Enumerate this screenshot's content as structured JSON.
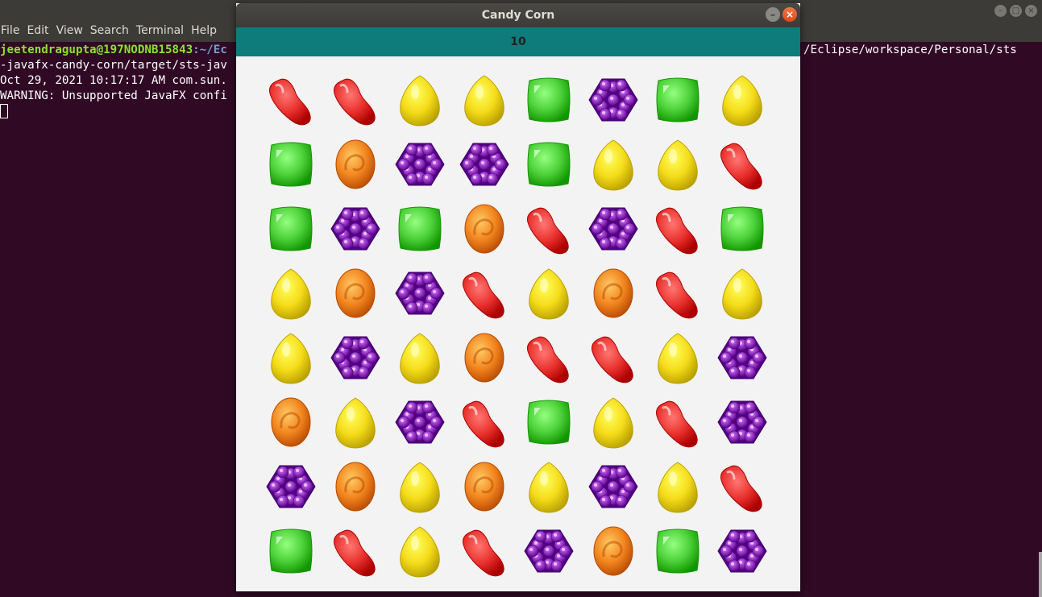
{
  "terminal": {
    "menu": [
      "File",
      "Edit",
      "View",
      "Search",
      "Terminal",
      "Help"
    ],
    "prompt_user": "jeetendragupta@197NODNB15843",
    "prompt_path": ":~/Ec",
    "path_right": "/Eclipse/workspace/Personal/sts",
    "line2": "-javafx-candy-corn/target/sts-jav",
    "line3": "Oct 29, 2021 10:17:17 AM com.sun.",
    "line4": "WARNING: Unsupported JavaFX confi"
  },
  "window": {
    "title": "Candy Corn",
    "score": "10"
  },
  "colors": {
    "red": "#e8302c",
    "yellow": "#f5dc1a",
    "green": "#4ed23a",
    "orange": "#f2851f",
    "purple": "#8e2fbd",
    "teal": "#0e7c7b"
  },
  "board": [
    [
      "red",
      "red",
      "yellow",
      "yellow",
      "green",
      "purple",
      "green",
      "yellow"
    ],
    [
      "green",
      "orange",
      "purple",
      "purple",
      "green",
      "yellow",
      "yellow",
      "red"
    ],
    [
      "green",
      "purple",
      "green",
      "orange",
      "red",
      "purple",
      "red",
      "green"
    ],
    [
      "yellow",
      "orange",
      "purple",
      "red",
      "yellow",
      "orange",
      "red",
      "yellow"
    ],
    [
      "yellow",
      "purple",
      "yellow",
      "orange",
      "red",
      "red",
      "yellow",
      "purple"
    ],
    [
      "orange",
      "yellow",
      "purple",
      "red",
      "green",
      "yellow",
      "red",
      "purple"
    ],
    [
      "purple",
      "orange",
      "yellow",
      "orange",
      "yellow",
      "purple",
      "yellow",
      "red"
    ],
    [
      "green",
      "red",
      "yellow",
      "red",
      "purple",
      "orange",
      "green",
      "purple"
    ]
  ]
}
